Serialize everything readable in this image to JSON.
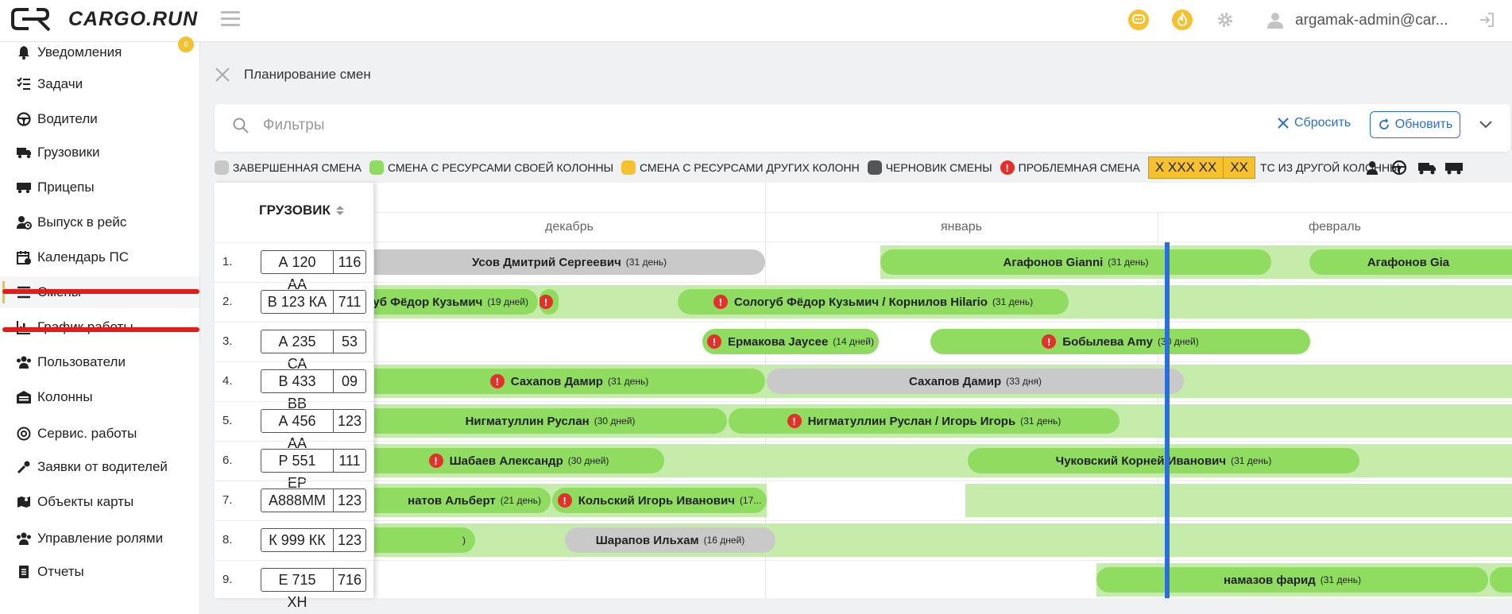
{
  "app": {
    "brand": "CARGO.RUN",
    "user": "argamak-admin@car..."
  },
  "colors": {
    "accent": "#f6c12f",
    "own": "#8fdc60",
    "done": "#c9c9c9",
    "draft": "#555555",
    "problem": "#e4302b",
    "today": "#2a6ede"
  },
  "sidebar": {
    "notif_badge": "6",
    "items": [
      {
        "label": "Уведомления",
        "icon": "bell-icon"
      },
      {
        "label": "Задачи",
        "icon": "task-list-icon"
      },
      {
        "label": "Водители",
        "icon": "steering-wheel-icon"
      },
      {
        "label": "Грузовики",
        "icon": "truck-icon"
      },
      {
        "label": "Прицепы",
        "icon": "trailer-icon"
      },
      {
        "label": "Выпуск в рейс",
        "icon": "user-clock-icon"
      },
      {
        "label": "Календарь ПС",
        "icon": "calendar-icon"
      },
      {
        "label": "Смены",
        "icon": "list-icon"
      },
      {
        "label": "График работы",
        "icon": "chart-icon"
      },
      {
        "label": "Пользователи",
        "icon": "users-icon"
      },
      {
        "label": "Колонны",
        "icon": "warehouse-icon"
      },
      {
        "label": "Сервис. работы",
        "icon": "service-icon"
      },
      {
        "label": "Заявки от водителей",
        "icon": "wrench-icon"
      },
      {
        "label": "Объекты карты",
        "icon": "map-icon"
      },
      {
        "label": "Управление ролями",
        "icon": "roles-icon"
      },
      {
        "label": "Отчеты",
        "icon": "report-icon"
      }
    ]
  },
  "page": {
    "title": "Планирование смен"
  },
  "filters": {
    "placeholder": "Фильтры",
    "reset": "Сбросить",
    "refresh": "Обновить"
  },
  "legend": {
    "done": "ЗАВЕРШЕННАЯ СМЕНА",
    "own": "СМЕНА С РЕСУРСАМИ СВОЕЙ КОЛОННЫ",
    "other": "СМЕНА С РЕСУРСАМИ ДРУГИХ КОЛОНН",
    "draft": "ЧЕРНОВИК СМЕНЫ",
    "problem": "ПРОБЛЕМНАЯ СМЕНА",
    "plate_a": "X XXX XX",
    "plate_b": "XX",
    "other_ts": "ТС ИЗ ДРУГОЙ КОЛОННЫ"
  },
  "table": {
    "column_header": "ГРУЗОВИК",
    "months": [
      "декабрь",
      "январь",
      "февраль"
    ],
    "rows": [
      {
        "num": "1.",
        "plate": "А 120 АА",
        "region": "116"
      },
      {
        "num": "2.",
        "plate": "В 123 КА",
        "region": "711"
      },
      {
        "num": "3.",
        "plate": "А 235 СА",
        "region": "53"
      },
      {
        "num": "4.",
        "plate": "В 433 ВВ",
        "region": "09"
      },
      {
        "num": "5.",
        "plate": "А 456 АА",
        "region": "123"
      },
      {
        "num": "6.",
        "plate": "Р 551 ЕР",
        "region": "111"
      },
      {
        "num": "7.",
        "plate": "А888ММ",
        "region": "123"
      },
      {
        "num": "8.",
        "plate": "К 999 КК",
        "region": "123"
      },
      {
        "num": "9.",
        "plate": "Е 715 ХН",
        "region": "716"
      }
    ],
    "shifts": [
      {
        "name": "Усов Дмитрий Сергеевич",
        "dur": "(31 день)"
      },
      {
        "name": "Агафонов Gianni",
        "dur": "(31 день)"
      },
      {
        "name": "Агафонов Gia",
        "dur": ""
      },
      {
        "name": "уб Фёдор Кузьмич",
        "dur": "(19 дней)"
      },
      {
        "name": "Сологуб Фёдор Кузьмич / Корнилов Hilario",
        "dur": "(31 день)"
      },
      {
        "name": "Ермакова Jaycee",
        "dur": "(14 дней)"
      },
      {
        "name": "Бобылева Amy",
        "dur": "(30 дней)"
      },
      {
        "name": "Сахапов Дамир",
        "dur": "(31 день)"
      },
      {
        "name": "Сахапов Дамир",
        "dur": "(33 дня)"
      },
      {
        "name": "Нигматуллин Руслан",
        "dur": "(30 дней)"
      },
      {
        "name": "Нигматуллин Руслан  / Игорь Игорь",
        "dur": "(31 день)"
      },
      {
        "name": "Шабаев Александр",
        "dur": "(30 дней)"
      },
      {
        "name": "Чуковский Корней Иванович",
        "dur": "(31 день)"
      },
      {
        "name": "натов Альберт",
        "dur": "(21 день)"
      },
      {
        "name": "Кольский Игорь Иванович",
        "dur": "(17..."
      },
      {
        "name": "",
        "dur": ")"
      },
      {
        "name": "Шарапов Ильхам",
        "dur": "(16 дней)"
      },
      {
        "name": "намазов фарид",
        "dur": "(31 день)"
      }
    ]
  }
}
